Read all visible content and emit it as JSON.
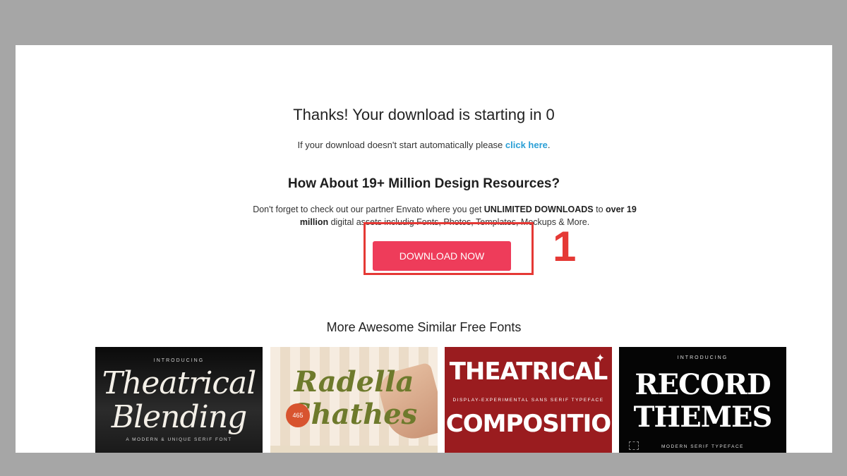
{
  "main": {
    "title": "Thanks! Your download is starting in 0",
    "subtitle_text": "If your download doesn't start automatically please ",
    "subtitle_link": "click here",
    "subtitle_end": ".",
    "promo_heading": "How About 19+ Million Design Resources?",
    "promo_p1": "Don't forget to check out our partner Envato where you get ",
    "promo_b1": "UNLIMITED DOWNLOADS",
    "promo_p2": " to ",
    "promo_b2": "over 19 million",
    "promo_p3": " digital assets includig Fonts, Photos, Templates, Mockups & More.",
    "download_button": "DOWNLOAD NOW",
    "annotation_step": "1",
    "similar_heading": "More Awesome Similar Free Fonts"
  },
  "cards": [
    {
      "intro": "INTRODUCING",
      "line1": "Theatrical",
      "line2": "Blending",
      "tagline": "A MODERN & UNIQUE SERIF FONT"
    },
    {
      "line1": "Radella",
      "line2": "Shathes",
      "badge": "465"
    },
    {
      "line1": "THEATRICAL",
      "tagline": "DISPLAY-EXPERIMENTAL SANS SERIF TYPEFACE",
      "line2": "COMPOSITIO"
    },
    {
      "intro": "INTRODUCING",
      "line1": "RECORD",
      "line2": "THEMES",
      "tagline": "MODERN SERIF TYPEFACE"
    }
  ],
  "colors": {
    "accent": "#ee3c5a",
    "link": "#2a9fd6",
    "annotation": "#e53935"
  }
}
